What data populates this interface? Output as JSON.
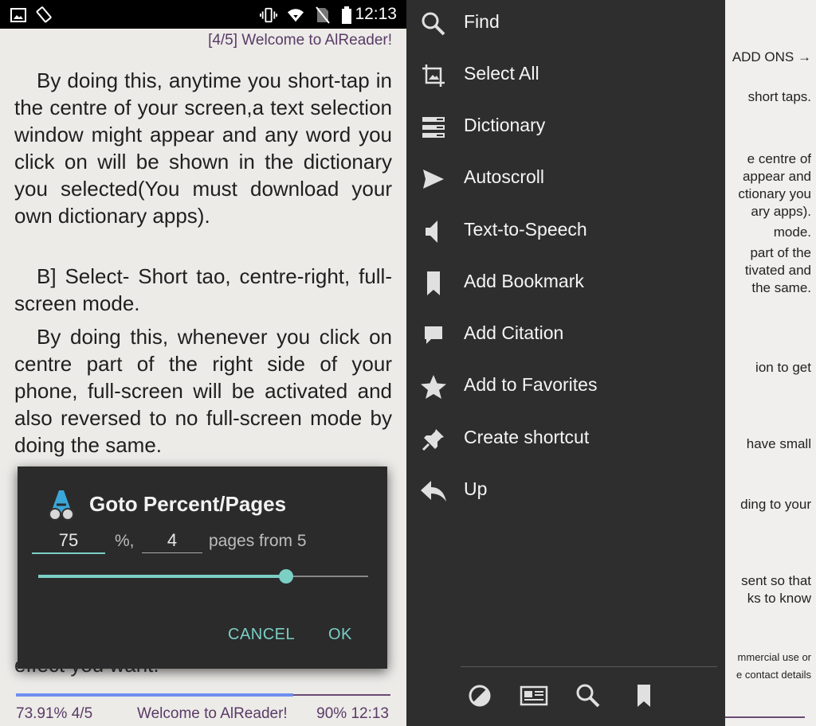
{
  "status_bar": {
    "time": "12:13",
    "icons": [
      "image-icon",
      "screen-rotation-icon",
      "vibrate-icon",
      "wifi-icon",
      "no-sim-icon",
      "battery-icon"
    ]
  },
  "reader": {
    "header": "[4/5] Welcome to AlReader!",
    "paragraphs": [
      "By doing this, anytime you short-tap in the centre of your screen,a text selection window might appear and any word you click on will be shown in the dictionary you selected(You must download your own dictionary apps).",
      "B] Select- Short tao, centre-right, full-screen mode.",
      "By doing this, whenever you click on centre part of the right side of your phone, full-screen will be activated and also reversed to no full-screen mode by doing the same."
    ],
    "behind_dialog_text": "effect you want.",
    "footer": {
      "left": "73.91% 4/5",
      "center": "Welcome to AlReader!",
      "right": "90% 12:13"
    },
    "progress": 0.74
  },
  "dialog": {
    "title": "Goto Percent/Pages",
    "percent_value": "75",
    "percent_suffix": "%,",
    "page_value": "4",
    "pages_label": "pages from 5",
    "slider_value": 0.75,
    "cancel_label": "CANCEL",
    "ok_label": "OK",
    "accent_color": "#7bcfc5"
  },
  "menu": {
    "items": [
      {
        "label": "Find",
        "icon": "search-icon"
      },
      {
        "label": "Select All",
        "icon": "crop-select-icon"
      },
      {
        "label": "Dictionary",
        "icon": "dictionary-icon"
      },
      {
        "label": "Autoscroll",
        "icon": "send-arrow-icon"
      },
      {
        "label": "Text-to-Speech",
        "icon": "speaker-icon"
      },
      {
        "label": "Add Bookmark",
        "icon": "bookmark-icon"
      },
      {
        "label": "Add Citation",
        "icon": "comment-icon"
      },
      {
        "label": "Add to Favorites",
        "icon": "star-icon"
      },
      {
        "label": "Create shortcut",
        "icon": "pin-icon"
      },
      {
        "label": "Up",
        "icon": "reply-arrow-icon"
      }
    ],
    "bottom_icons": [
      "contrast-icon",
      "newspaper-icon",
      "search-icon",
      "bookmark-icon"
    ]
  },
  "background_page": {
    "lines": [
      "ADD ONS →",
      "short taps.",
      "e centre of",
      "appear and",
      "ctionary you",
      "ary apps).",
      "mode.",
      "part of the",
      "tivated and",
      "the same.",
      "ion to get",
      "have small",
      "ding to your",
      "sent so that",
      "ks to know",
      "mmercial use or",
      "e contact details"
    ]
  }
}
